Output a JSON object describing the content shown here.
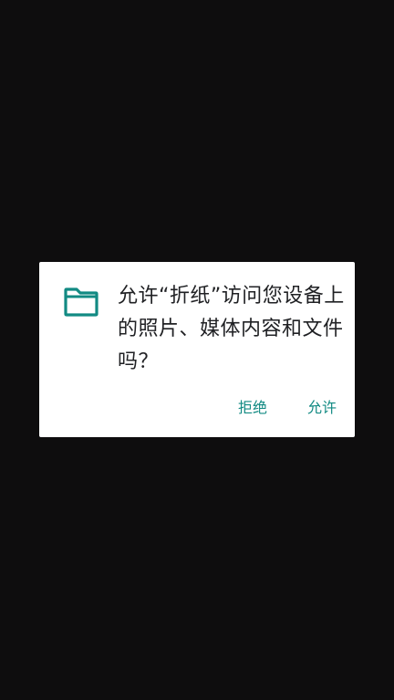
{
  "dialog": {
    "icon": "folder-icon",
    "message": "允许“折纸”访问您设备上的照片、媒体内容和文件吗？",
    "deny_label": "拒绝",
    "allow_label": "允许",
    "accent_color": "#128a83"
  }
}
